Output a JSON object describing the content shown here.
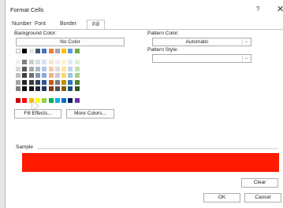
{
  "dialog": {
    "title": "Format Cells",
    "help_glyph": "?",
    "close_glyph": "✕"
  },
  "tabs": [
    "Number",
    "Font",
    "Border",
    "Fill"
  ],
  "active_tab": "Fill",
  "background_color": {
    "label": "Background Color:",
    "no_color_label": "No Color"
  },
  "pattern_color": {
    "label": "Pattern Color:",
    "value": "Automatic"
  },
  "pattern_style": {
    "label": "Pattern Style:",
    "value": ""
  },
  "buttons": {
    "fill_effects": "Fill Effects...",
    "more_colors": "More Colors...",
    "clear": "Clear",
    "ok": "OK",
    "cancel": "Cancel"
  },
  "sample": {
    "label": "Sample",
    "color": "#ff1a00"
  },
  "palette": {
    "theme_top_row": [
      "#ffffff",
      "#000000",
      "#e7e6e6",
      "#44546a",
      "#4472c4",
      "#ed7d31",
      "#a5a5a5",
      "#ffc000",
      "#5b9bd5",
      "#70ad47"
    ],
    "theme_rows": [
      [
        "#f2f2f2",
        "#808080",
        "#d0cece",
        "#d6dce4",
        "#d9e2f3",
        "#fbe5d5",
        "#ededed",
        "#fff2cc",
        "#deebf6",
        "#e2efd9"
      ],
      [
        "#d9d9d9",
        "#595959",
        "#aeabab",
        "#adb9ca",
        "#b4c6e7",
        "#f7cbac",
        "#dbdbdb",
        "#fee599",
        "#bdd7ee",
        "#c5e0b3"
      ],
      [
        "#bfbfbf",
        "#404040",
        "#757171",
        "#8496b0",
        "#8eaadb",
        "#f4b183",
        "#c9c9c9",
        "#ffd966",
        "#9cc3e5",
        "#a8d08d"
      ],
      [
        "#a6a6a6",
        "#262626",
        "#3a3838",
        "#323f4f",
        "#2f5496",
        "#c55a11",
        "#7b7b7b",
        "#bf9000",
        "#2e75b5",
        "#538135"
      ],
      [
        "#808080",
        "#0d0d0d",
        "#171616",
        "#222a35",
        "#1f3763",
        "#833c0b",
        "#525252",
        "#7f6000",
        "#1e4e79",
        "#375623"
      ]
    ],
    "standard_row": [
      "#c00000",
      "#ff0000",
      "#ffc000",
      "#ffff00",
      "#92d050",
      "#00b050",
      "#00b0f0",
      "#0070c0",
      "#002060",
      "#7030a0"
    ]
  }
}
